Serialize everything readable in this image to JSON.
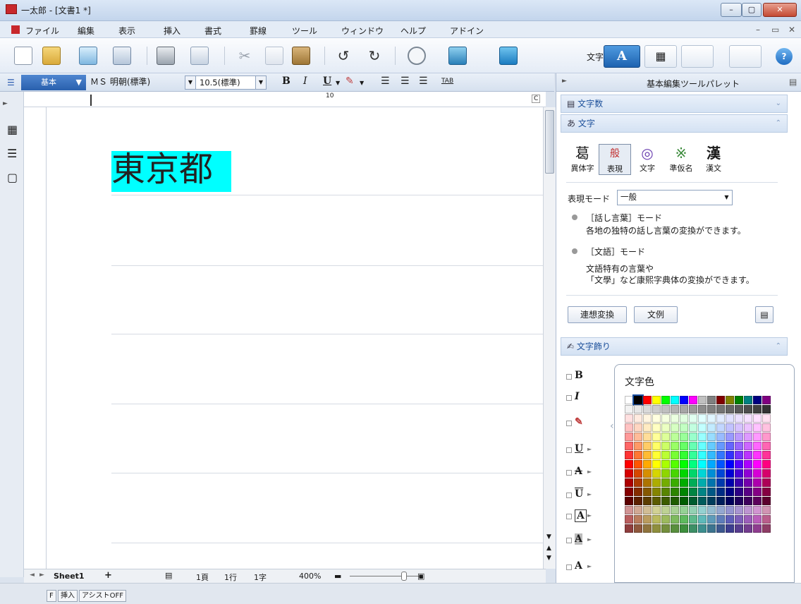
{
  "window": {
    "title": "一太郎 - [文書1 *]"
  },
  "menu": {
    "items": [
      "ファイル",
      "編集",
      "表示",
      "挿入",
      "書式",
      "罫線",
      "ツール",
      "ウィンドウ",
      "ヘルプ",
      "アドイン"
    ]
  },
  "toolbar": {
    "mode_label": "文字"
  },
  "format": {
    "style": "基本",
    "font": "ＭＳ 明朝(標準)",
    "size": "10.5(標準)",
    "bold": "B",
    "italic": "I",
    "underline": "U",
    "tab": "TAB"
  },
  "ruler": {
    "mark": "10"
  },
  "document": {
    "text": "東京都",
    "highlight_color": "#00ffff"
  },
  "status": {
    "sheet": "Sheet1",
    "page": "1頁",
    "line": "1行",
    "char": "1字",
    "zoom": "400%"
  },
  "bottom": {
    "mode1": "F",
    "mode2": "挿入",
    "mode3": "アシストOFF"
  },
  "palette": {
    "title": "基本編集ツールパレット",
    "sec_count": "文字数",
    "sec_char": "文字",
    "tools": [
      {
        "glyph": "葛",
        "label": "異体字"
      },
      {
        "glyph": "般",
        "label": "表現"
      },
      {
        "glyph": "◎",
        "label": "文字"
      },
      {
        "glyph": "※",
        "label": "準仮名"
      },
      {
        "glyph": "漢",
        "label": "漢文"
      }
    ],
    "mode_label": "表現モード",
    "mode_value": "一般",
    "bullets": [
      {
        "title": "［話し言葉］モード",
        "desc": "各地の独特の話し言葉の変換ができます。"
      },
      {
        "title": "［文語］モード",
        "desc": "文語特有の言葉や",
        "desc2": "「文學」など康熙字典体の変換ができます。"
      }
    ],
    "btn_assoc": "連想変換",
    "btn_example": "文例",
    "sec_deco": "文字飾り",
    "color_title": "文字色"
  }
}
